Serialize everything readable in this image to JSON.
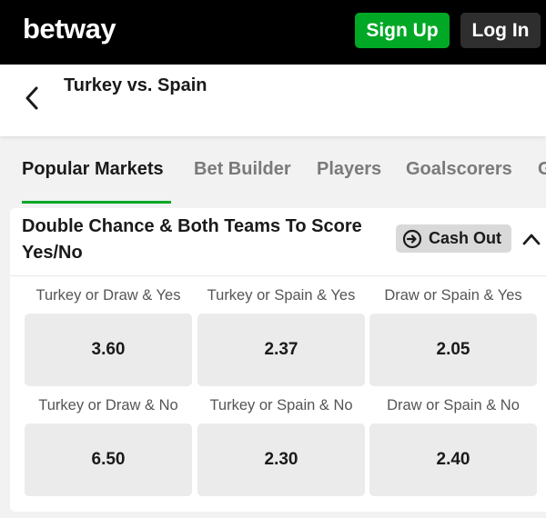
{
  "header": {
    "logo": "betway",
    "signup_label": "Sign Up",
    "login_label": "Log In"
  },
  "match": {
    "title": "Turkey vs. Spain",
    "back_icon": "chevron-left-icon"
  },
  "tabs": [
    {
      "label": "Popular Markets",
      "active": true
    },
    {
      "label": "Bet Builder",
      "active": false
    },
    {
      "label": "Players",
      "active": false
    },
    {
      "label": "Goalscorers",
      "active": false
    },
    {
      "label": "G",
      "active": false
    }
  ],
  "market": {
    "title": "Double Chance & Both Teams To Score Yes/No",
    "cashout_label": "Cash Out",
    "cashout_icon": "cash-out-icon",
    "collapse_icon": "chevron-up-icon",
    "outcomes": [
      {
        "label": "Turkey or Draw & Yes",
        "odds": "3.60"
      },
      {
        "label": "Turkey or Spain & Yes",
        "odds": "2.37"
      },
      {
        "label": "Draw or Spain & Yes",
        "odds": "2.05"
      },
      {
        "label": "Turkey or Draw & No",
        "odds": "6.50"
      },
      {
        "label": "Turkey or Spain & No",
        "odds": "2.30"
      },
      {
        "label": "Draw or Spain & No",
        "odds": "2.40"
      }
    ]
  },
  "colors": {
    "brand_green": "#00a826",
    "header_bg": "#000000",
    "login_bg": "#2e2e2e",
    "odds_bg": "#ebebeb"
  }
}
